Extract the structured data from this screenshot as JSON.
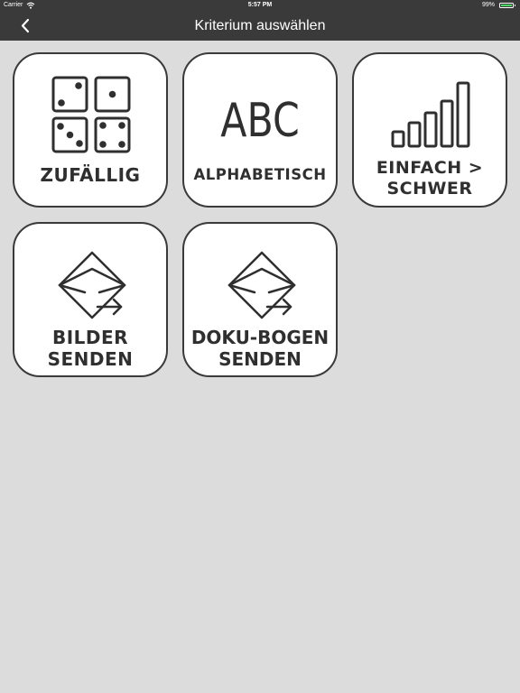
{
  "status_bar": {
    "carrier": "Carrier",
    "time": "5:57 PM",
    "battery": "99%",
    "battery_level": 0.99
  },
  "nav": {
    "title": "Kriterium auswählen",
    "back_icon": "chevron-left-icon"
  },
  "tiles": [
    {
      "id": "zufaellig",
      "icon": "dice-icon",
      "lines": [
        "ZUFÄLLIG"
      ]
    },
    {
      "id": "alphabetisch",
      "icon": "abc-icon",
      "icon_text": "ABC",
      "lines": [
        "ALPHABETISCH"
      ]
    },
    {
      "id": "einfach-schwer",
      "icon": "signal-bars-icon",
      "lines": [
        "EINFACH >",
        "SCHWER"
      ]
    },
    {
      "id": "bilder-senden",
      "icon": "mail-send-icon",
      "lines": [
        "BILDER",
        "SENDEN"
      ]
    },
    {
      "id": "doku-bogen-senden",
      "icon": "mail-send-icon",
      "lines": [
        "DOKU-BOGEN",
        "SENDEN"
      ]
    }
  ],
  "colors": {
    "background": "#dcdcdc",
    "bar": "#3a3a3a",
    "tile_border": "#3a3a3a",
    "tile_fill": "#ffffff",
    "battery": "#4cd964"
  }
}
